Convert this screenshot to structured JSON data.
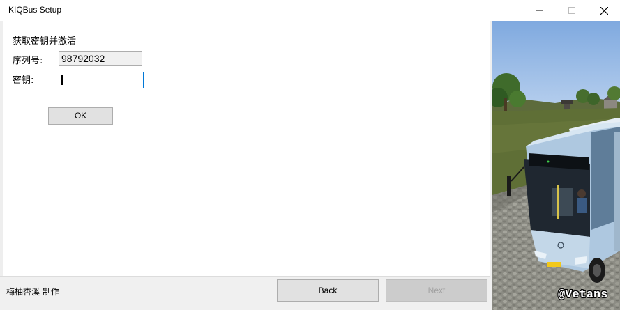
{
  "window": {
    "title": "KIQBus Setup"
  },
  "form": {
    "heading": "获取密钥并激活",
    "serial_label": "序列号:",
    "serial_value": "98792032",
    "key_label": "密钥:",
    "key_value": "",
    "ok_label": "OK"
  },
  "footer": {
    "credit": "梅柚杏溪 制作",
    "back_label": "Back",
    "next_label": "Next"
  },
  "side_image": {
    "watermark": "@Vetans"
  }
}
